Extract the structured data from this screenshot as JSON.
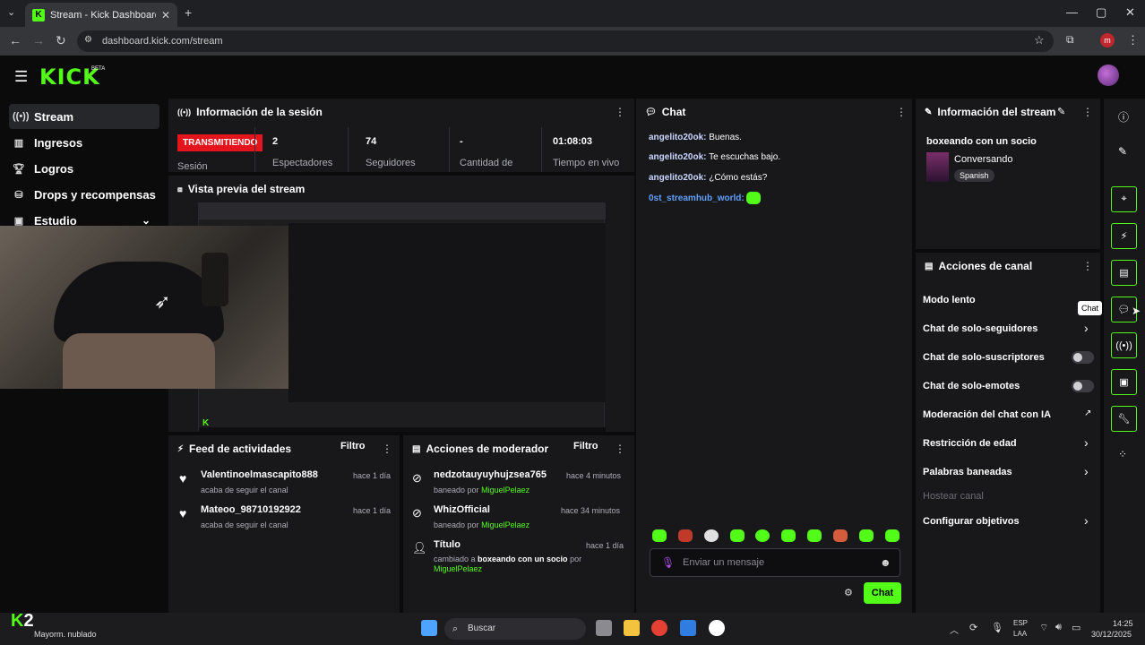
{
  "browser": {
    "tab_title": "Stream - Kick Dashboard",
    "url": "dashboard.kick.com/stream",
    "profile_initial": "m"
  },
  "brand": {
    "logo": "KICK",
    "beta": "BETA"
  },
  "sidebar": {
    "items": [
      {
        "label": "Stream",
        "icon": "broadcast-icon"
      },
      {
        "label": "Ingresos",
        "icon": "chart-icon"
      },
      {
        "label": "Logros",
        "icon": "trophy-icon"
      },
      {
        "label": "Drops y recompensas",
        "icon": "gift-icon"
      },
      {
        "label": "Estudio",
        "icon": "studio-icon"
      }
    ]
  },
  "session": {
    "title": "Información de la sesión",
    "live_badge": "TRANSMITIENDO",
    "session_label": "Sesión",
    "stats": [
      {
        "value": "2",
        "label": "Espectadores"
      },
      {
        "value": "74",
        "label": "Seguidores"
      },
      {
        "value": "-",
        "label": "Cantidad de"
      },
      {
        "value": "01:08:03",
        "label": "Tiempo en vivo"
      }
    ]
  },
  "preview": {
    "title": "Vista previa del stream"
  },
  "activity": {
    "title": "Feed de actividades",
    "filter": "Filtro",
    "items": [
      {
        "name": "Valentinoelmascapito888",
        "sub": "acaba de seguir el canal",
        "time": "hace 1 día"
      },
      {
        "name": "Mateoo_98710192922",
        "sub": "acaba de seguir el canal",
        "time": "hace 1 día"
      }
    ]
  },
  "moderator": {
    "title": "Acciones de moderador",
    "filter": "Filtro",
    "items": [
      {
        "name": "nedzotauyuyhujzsea765",
        "sub": "baneado por",
        "by": "MiguelPelaez",
        "time": "hace 4 minutos"
      },
      {
        "name": "WhizOfficial",
        "sub": "baneado por",
        "by": "MiguelPelaez",
        "time": "hace 34 minutos"
      },
      {
        "name": "Título",
        "sub": "cambiado a",
        "bold": "boxeando con un socio",
        "por": "por",
        "by": "MiguelPelaez",
        "time": "hace 1 día"
      }
    ]
  },
  "chat": {
    "title": "Chat",
    "messages": [
      {
        "user": "angelito20ok:",
        "text": "Buenas."
      },
      {
        "user": "angelito20ok:",
        "text": "Te escuchas bajo."
      },
      {
        "user": "angelito20ok:",
        "text": "¿Cómo estás?"
      },
      {
        "user": "0st_streamhub_world:",
        "text": ""
      }
    ],
    "placeholder": "Enviar un mensaje",
    "send_label": "Chat"
  },
  "stream_info": {
    "title": "Información del stream",
    "stream_title": "boxeando con un socio",
    "category": "Conversando",
    "language": "Spanish"
  },
  "channel_actions": {
    "title": "Acciones de canal",
    "items": [
      {
        "label": "Modo lento",
        "control": "chevron"
      },
      {
        "label": "Chat de solo-seguidores",
        "control": "chevron"
      },
      {
        "label": "Chat de solo-suscriptores",
        "control": "toggle"
      },
      {
        "label": "Chat de solo-emotes",
        "control": "toggle"
      },
      {
        "label": "Moderación del chat con IA",
        "control": "external"
      },
      {
        "label": "Restricción de edad",
        "control": "chevron"
      },
      {
        "label": "Palabras baneadas",
        "control": "chevron"
      },
      {
        "label": "Hostear canal",
        "control": "none"
      },
      {
        "label": "Configurar objetivos",
        "control": "chevron"
      }
    ]
  },
  "tooltip": "Chat",
  "taskbar": {
    "search": "Buscar",
    "weather": "Mayorm. nublado",
    "lang_top": "ESP",
    "lang_bottom": "LAA",
    "time": "14:25",
    "date": "30/12/2025"
  },
  "overlay": {
    "kick_count": "2"
  },
  "colors": {
    "accent": "#53fc18",
    "live": "#e3141b",
    "panel": "#18181b",
    "background": "#0b0b0c"
  }
}
